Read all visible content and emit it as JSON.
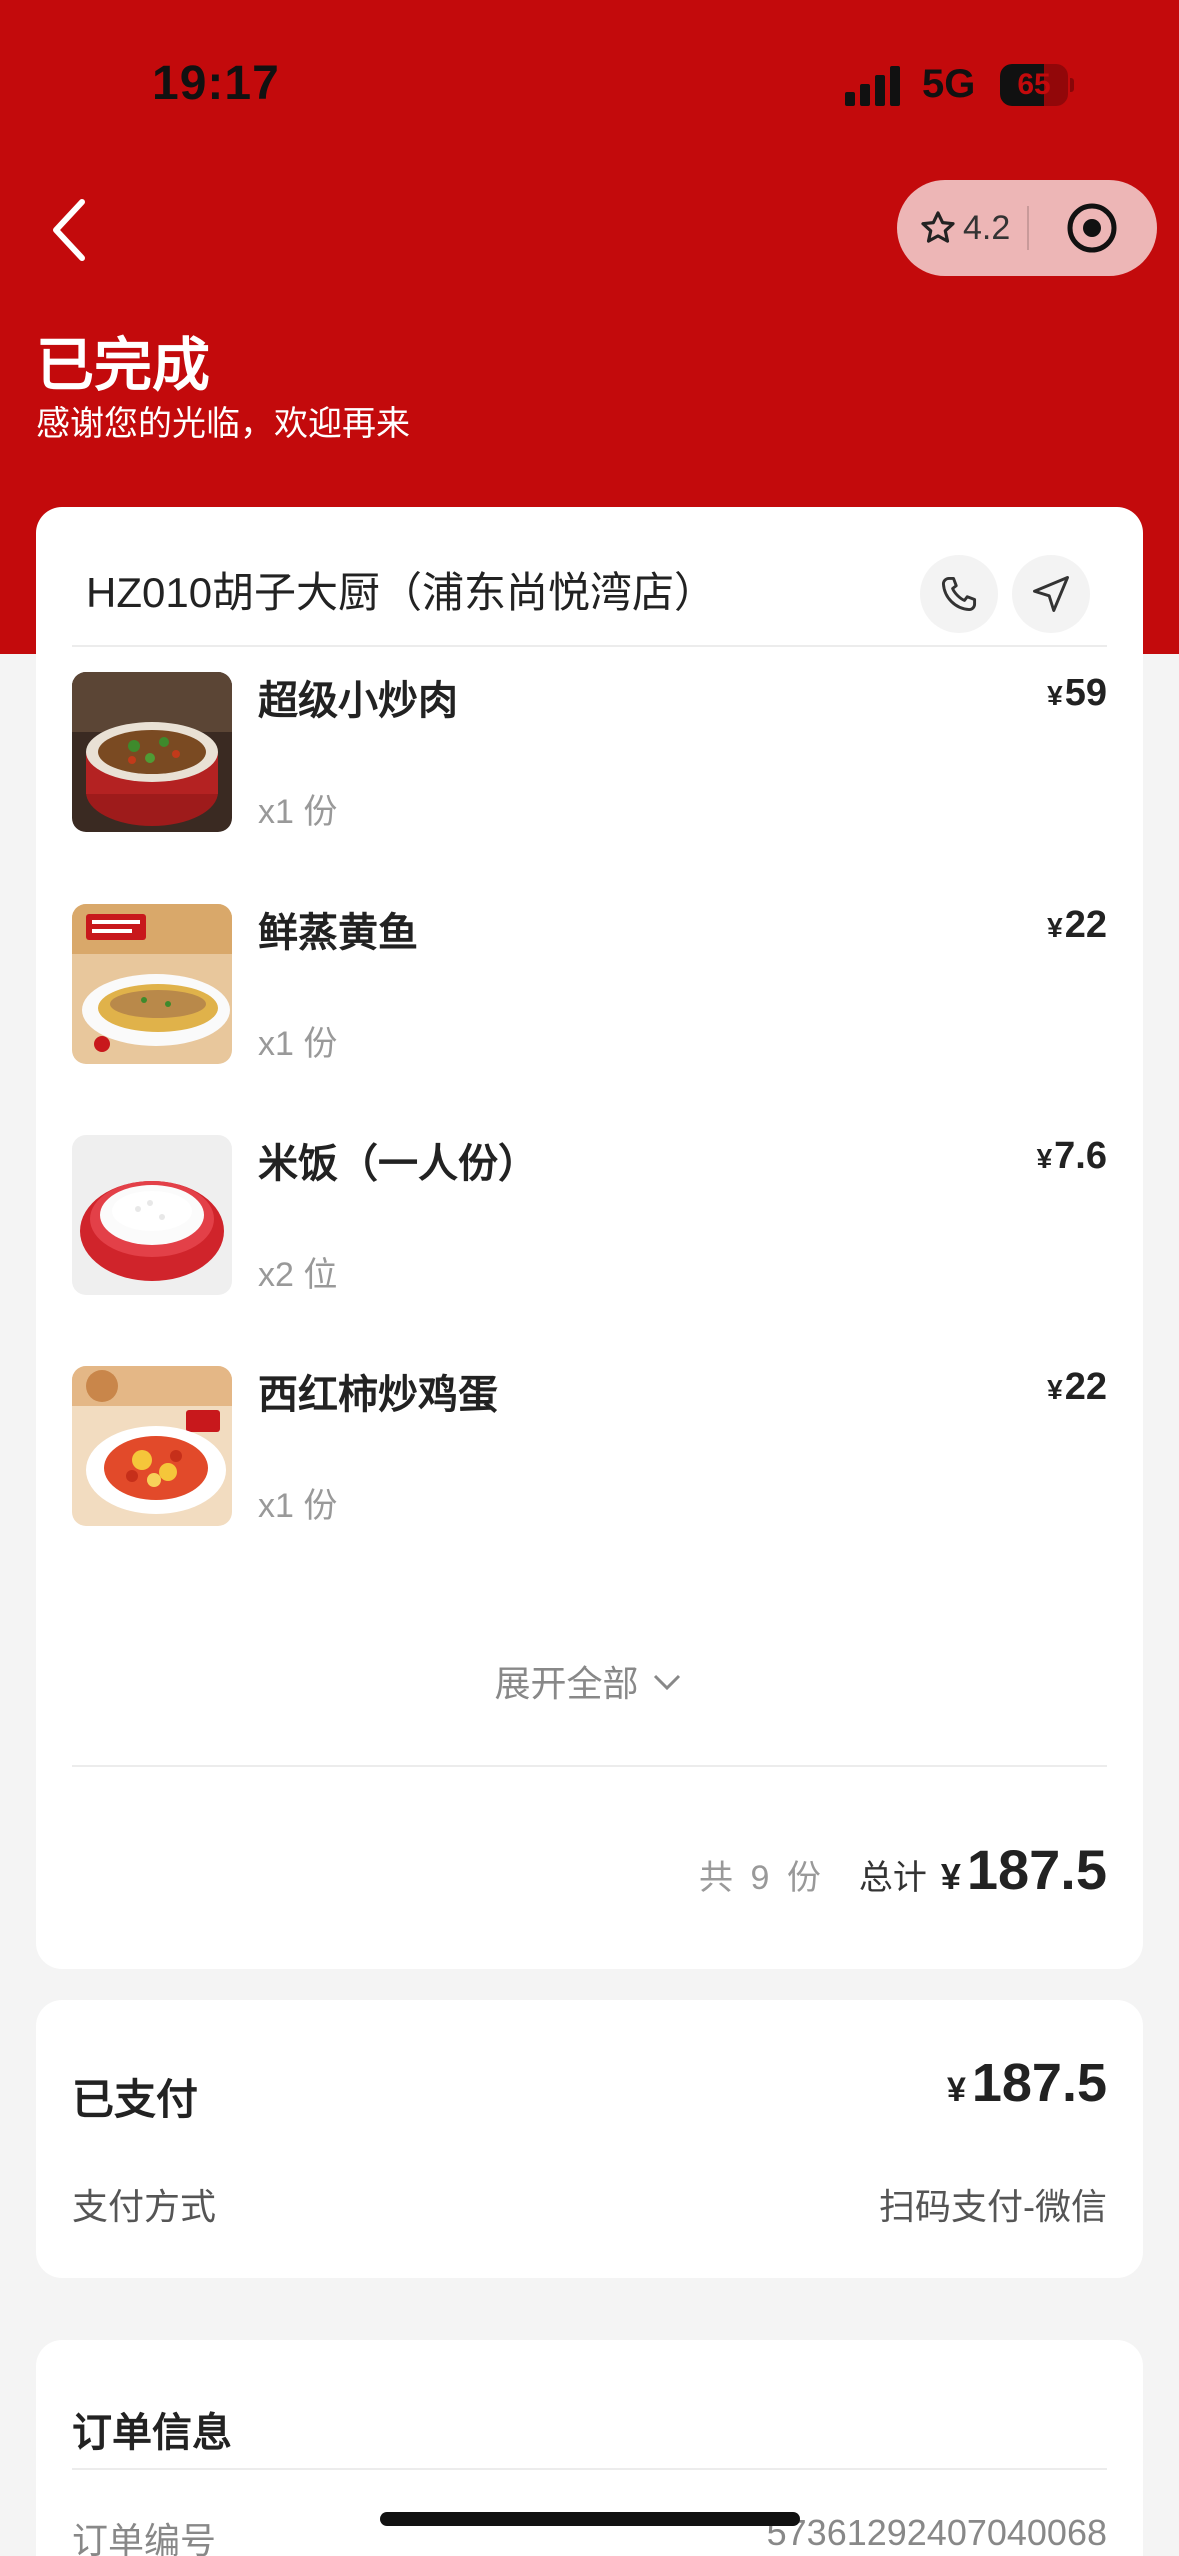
{
  "status_bar": {
    "time": "19:17",
    "network": "5G",
    "battery": "65",
    "battery_fraction": 0.65
  },
  "header": {
    "rating": "4.2",
    "title": "已完成",
    "subtitle": "感谢您的光临，欢迎再来"
  },
  "shop": {
    "name": "HZ010胡子大厨（浦东尚悦湾店）"
  },
  "items": [
    {
      "name": "超级小炒肉",
      "qty": "x1 份",
      "yen": "¥",
      "price": "59"
    },
    {
      "name": "鲜蒸黄鱼",
      "qty": "x1 份",
      "yen": "¥",
      "price": "22"
    },
    {
      "name": "米饭（一人份）",
      "qty": "x2 位",
      "yen": "¥",
      "price": "7.6"
    },
    {
      "name": "西红柿炒鸡蛋",
      "qty": "x1 份",
      "yen": "¥",
      "price": "22"
    }
  ],
  "expand_label": "展开全部",
  "summary": {
    "count": "共 9 份",
    "total_label": "总计",
    "yen": "¥",
    "total": "187.5"
  },
  "payment": {
    "paid_label": "已支付",
    "yen": "¥",
    "amount": "187.5",
    "method_label": "支付方式",
    "method_value": "扫码支付-微信"
  },
  "order_info": {
    "title": "订单信息",
    "order_no_label": "订单编号",
    "order_no_value": "5736129240704006​8"
  },
  "colors": {
    "brand_red": "#c30a0c",
    "page_bg": "#f4f4f4"
  }
}
